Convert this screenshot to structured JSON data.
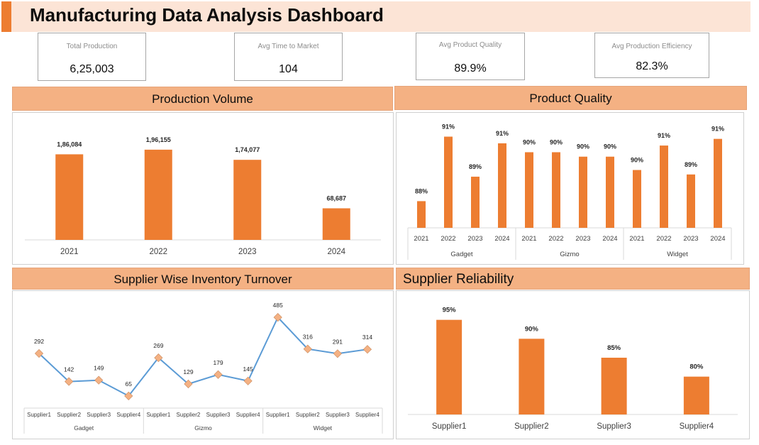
{
  "dashboard": {
    "title": "Manufacturing Data Analysis Dashboard",
    "accent_color": "#ed7d31",
    "header_color": "#f4b183",
    "title_bg_color": "#fce4d6"
  },
  "kpis": [
    {
      "label": "Total Production",
      "value": "6,25,003"
    },
    {
      "label": "Avg Time to Market",
      "value": "104"
    },
    {
      "label": "Avg Product Quality",
      "value": "89.9%"
    },
    {
      "label": "Avg Production Efficiency",
      "value": "82.3%"
    }
  ],
  "panels": {
    "production_volume": "Production Volume",
    "product_quality": "Product Quality",
    "inventory_turnover": "Supplier Wise Inventory Turnover",
    "supplier_reliability": "Supplier Reliability"
  },
  "chart_data": [
    {
      "type": "bar",
      "title": "Production Volume",
      "categories": [
        "2021",
        "2022",
        "2023",
        "2024"
      ],
      "values": [
        186084,
        196155,
        174077,
        68687
      ],
      "data_labels": [
        "1,86,084",
        "1,96,155",
        "1,74,077",
        "68,687"
      ],
      "ylim": [
        0,
        250000
      ],
      "grid": false,
      "color": "#ed7d31"
    },
    {
      "type": "bar",
      "title": "Product Quality",
      "groups": [
        {
          "name": "Gadget",
          "categories": [
            "2021",
            "2022",
            "2023",
            "2024"
          ],
          "values": [
            88,
            91,
            89,
            91
          ]
        },
        {
          "name": "Gizmo",
          "categories": [
            "2021",
            "2022",
            "2023",
            "2024"
          ],
          "values": [
            90,
            90,
            90,
            90
          ]
        },
        {
          "name": "Widget",
          "categories": [
            "2021",
            "2022",
            "2023",
            "2024"
          ],
          "values": [
            90,
            91,
            89,
            91
          ]
        }
      ],
      "actual_values": [
        88.2,
        91.1,
        89.3,
        90.8,
        90.4,
        90.4,
        90.2,
        90.2,
        89.6,
        90.7,
        89.4,
        91.0
      ],
      "value_suffix": "%",
      "ylim": [
        87,
        91.5
      ],
      "grid": false,
      "color": "#ed7d31"
    },
    {
      "type": "line",
      "title": "Supplier Wise Inventory Turnover",
      "groups": [
        {
          "name": "Gadget",
          "categories": [
            "Supplier1",
            "Supplier2",
            "Supplier3",
            "Supplier4"
          ],
          "values": [
            292,
            142,
            149,
            65
          ]
        },
        {
          "name": "Gizmo",
          "categories": [
            "Supplier1",
            "Supplier2",
            "Supplier3",
            "Supplier4"
          ],
          "values": [
            269,
            129,
            179,
            145
          ]
        },
        {
          "name": "Widget",
          "categories": [
            "Supplier1",
            "Supplier2",
            "Supplier3",
            "Supplier4"
          ],
          "values": [
            485,
            316,
            291,
            314
          ]
        }
      ],
      "ylim": [
        0,
        550
      ],
      "grid": false,
      "line_color": "#5b9bd5",
      "marker_color": "#f4b183"
    },
    {
      "type": "bar",
      "title": "Supplier Reliability",
      "categories": [
        "Supplier1",
        "Supplier2",
        "Supplier3",
        "Supplier4"
      ],
      "values": [
        95,
        90,
        85,
        80
      ],
      "value_suffix": "%",
      "ylim": [
        70,
        97
      ],
      "grid": false,
      "color": "#ed7d31"
    }
  ]
}
